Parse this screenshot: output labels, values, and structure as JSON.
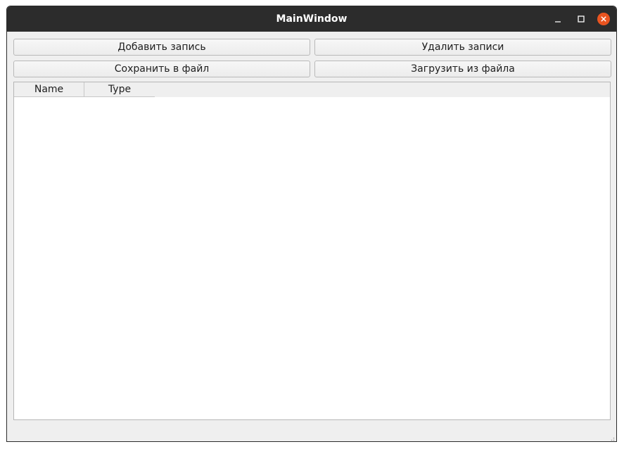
{
  "window": {
    "title": "MainWindow"
  },
  "titlebar_controls": {
    "minimize_icon": "minimize-icon",
    "maximize_icon": "maximize-icon",
    "close_icon": "close-icon",
    "close_color": "#e95420"
  },
  "toolbar": {
    "add_label": "Добавить запись",
    "delete_label": "Удалить записи",
    "save_label": "Сохранить в файл",
    "load_label": "Загрузить из файла"
  },
  "table": {
    "columns": [
      "Name",
      "Type"
    ],
    "rows": []
  },
  "status_bar": {
    "size_grip_icon": "size-grip-icon"
  }
}
